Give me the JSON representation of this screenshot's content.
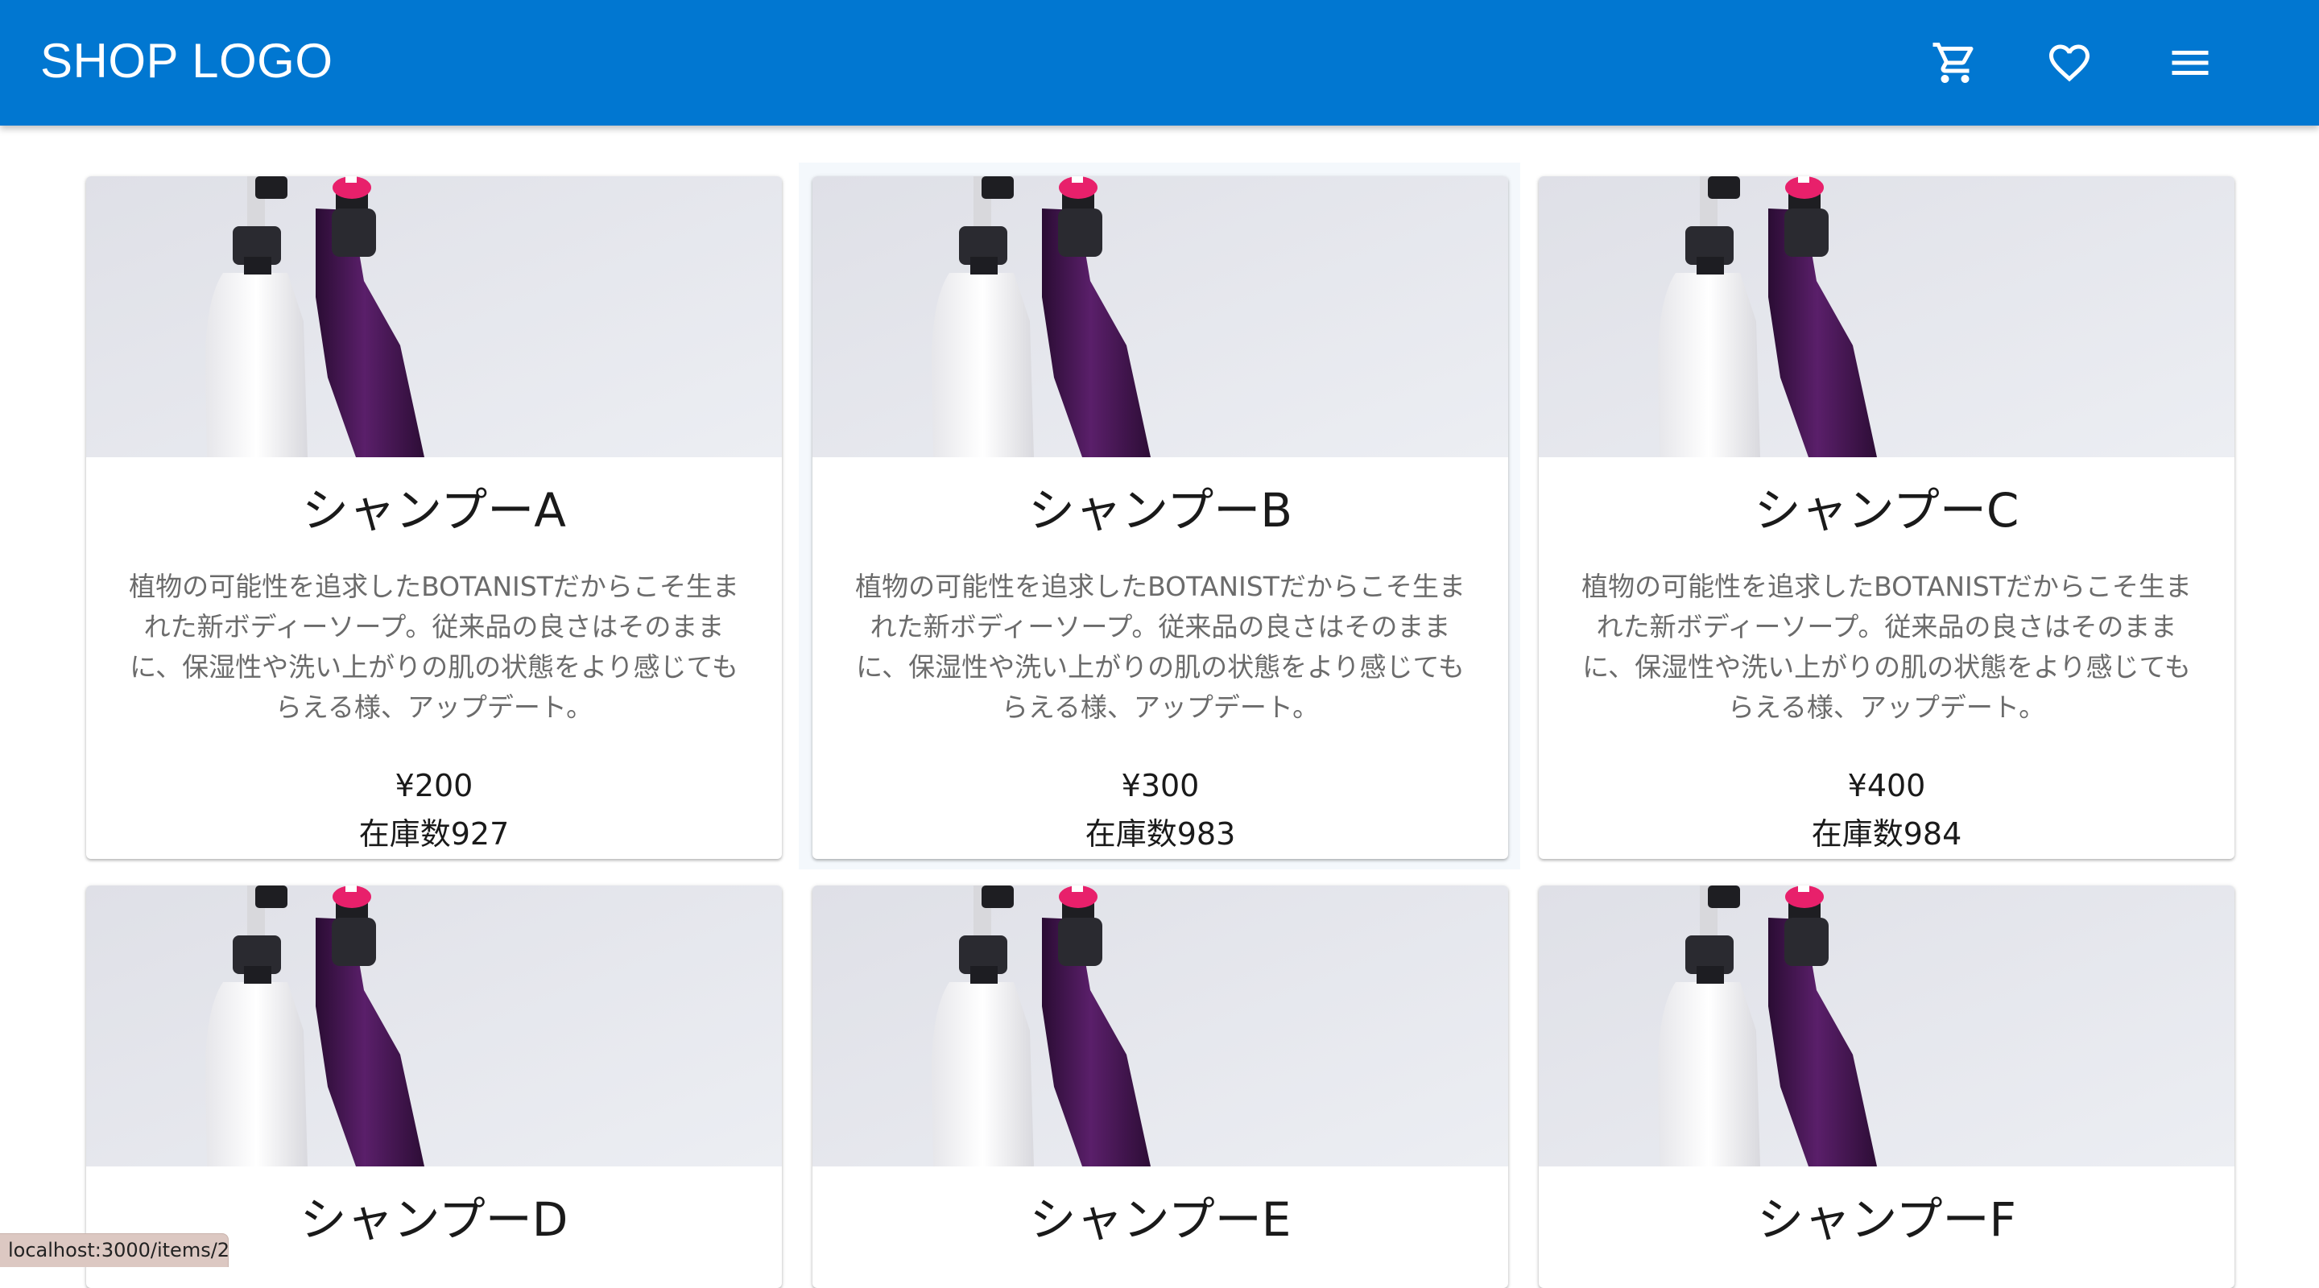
{
  "header": {
    "logo": "SHOP LOGO",
    "icons": [
      "cart-icon",
      "heart-icon",
      "menu-icon"
    ],
    "background": "#0177d1"
  },
  "products": [
    {
      "name": "シャンプーA",
      "description": "植物の可能性を追求したBOTANISTだからこそ生まれた新ボディーソープ。従来品の良さはそのままに、保湿性や洗い上がりの肌の状態をより感じてもらえる様、アップデート。",
      "price": "¥200",
      "stock": "在庫数927"
    },
    {
      "name": "シャンプーB",
      "description": "植物の可能性を追求したBOTANISTだからこそ生まれた新ボディーソープ。従来品の良さはそのままに、保湿性や洗い上がりの肌の状態をより感じてもらえる様、アップデート。",
      "price": "¥300",
      "stock": "在庫数983"
    },
    {
      "name": "シャンプーC",
      "description": "植物の可能性を追求したBOTANISTだからこそ生まれた新ボディーソープ。従来品の良さはそのままに、保湿性や洗い上がりの肌の状態をより感じてもらえる様、アップデート。",
      "price": "¥400",
      "stock": "在庫数984"
    },
    {
      "name": "シャンプーD"
    },
    {
      "name": "シャンプーE"
    },
    {
      "name": "シャンプーF"
    }
  ],
  "status_bar": {
    "url": "localhost:3000/items/2"
  }
}
